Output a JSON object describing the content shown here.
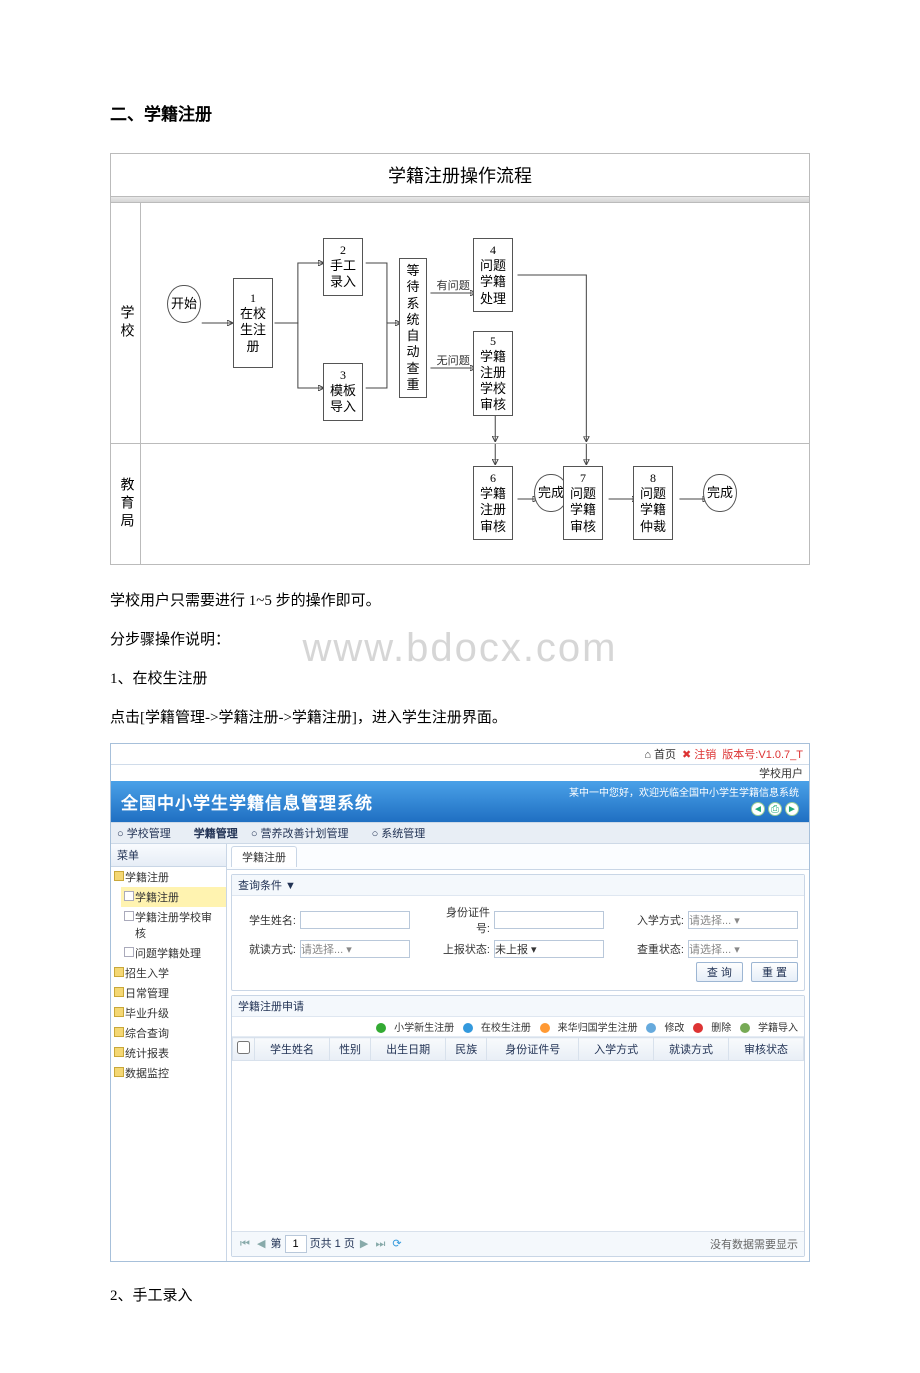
{
  "doc": {
    "section_title": "二、学籍注册",
    "flow_title": "学籍注册操作流程",
    "lane1_label": "学校",
    "lane2_label": "教育局",
    "nodes": {
      "start": "开始",
      "n1_num": "1",
      "n1": "在校生注册",
      "n2_num": "2",
      "n2": "手工录入",
      "n3_num": "3",
      "n3": "模板导入",
      "wait": "等待系统自动查重",
      "c1": "有问题",
      "c2": "无问题",
      "n4_num": "4",
      "n4": "问题学籍处理",
      "n5_num": "5",
      "n5": "学籍注册学校审核",
      "n6_num": "6",
      "n6": "学籍注册审核",
      "done1": "完成",
      "n7_num": "7",
      "n7": "问题学籍审核",
      "n8_num": "8",
      "n8": "问题学籍仲裁",
      "done2": "完成"
    },
    "watermark": "www.bdocx.com",
    "p1": "学校用户只需要进行 1~5 步的操作即可。",
    "p2": "分步骤操作说明：",
    "p3": "1、在校生注册",
    "p4": "点击[学籍管理->学籍注册->学籍注册]，进入学生注册界面。",
    "p5": "2、手工录入"
  },
  "shot": {
    "top": {
      "home": "首页",
      "logout": "注销",
      "ver_label": "版本号",
      "ver": "V1.0.7_T",
      "user": "学校用户"
    },
    "banner": {
      "title": "全国中小学生学籍信息管理系统",
      "welcome": "某中一中您好，欢迎光临全国中小学生学籍信息系统"
    },
    "menu": {
      "m1": "学校管理",
      "m2": "学籍管理",
      "m3": "营养改善计划管理",
      "m4": "系统管理"
    },
    "side_title": "菜单",
    "tree": {
      "t1": "学籍注册",
      "t1a": "学籍注册",
      "t1b": "学籍注册学校审核",
      "t1c": "问题学籍处理",
      "t2": "招生入学",
      "t3": "日常管理",
      "t4": "毕业升级",
      "t5": "综合查询",
      "t6": "统计报表",
      "t7": "数据监控"
    },
    "tab": "学籍注册",
    "search": {
      "title": "查询条件 ▼",
      "l1": "学生姓名:",
      "l2": "身份证件号:",
      "l3": "入学方式:",
      "l4": "就读方式:",
      "l5": "上报状态:",
      "l6": "查重状态:",
      "sel_placeholder": "请选择...",
      "sel_unreported": "未上报",
      "btn_search": "查 询",
      "btn_reset": "重 置"
    },
    "grid": {
      "title": "学籍注册申请",
      "tools": {
        "a": "小学新生注册",
        "b": "在校生注册",
        "c": "来华归国学生注册",
        "d": "修改",
        "e": "删除",
        "f": "学籍导入"
      },
      "cols": {
        "c0": "",
        "c1": "学生姓名",
        "c2": "性别",
        "c3": "出生日期",
        "c4": "民族",
        "c5": "身份证件号",
        "c6": "入学方式",
        "c7": "就读方式",
        "c8": "审核状态"
      }
    },
    "pager": {
      "page_label": "第",
      "page_val": "1",
      "of": "页共 1 页",
      "empty": "没有数据需要显示"
    }
  }
}
